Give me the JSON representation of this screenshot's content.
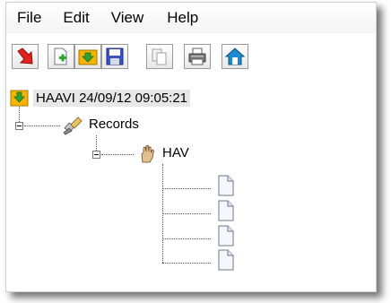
{
  "menu": {
    "file": "File",
    "edit": "Edit",
    "view": "View",
    "help": "Help"
  },
  "toolbar": {
    "buttons": [
      {
        "icon": "exit-arrow-icon",
        "color": "#e0241c"
      },
      {
        "icon": "new-document-icon",
        "color": "#2fa32f"
      },
      {
        "icon": "open-folder-icon",
        "color": "#f5b400"
      },
      {
        "icon": "save-disk-icon",
        "color": "#3a52c8"
      },
      {
        "icon": "copy-icon",
        "color": "#a0a0a0"
      },
      {
        "icon": "print-icon",
        "color": "#606060"
      },
      {
        "icon": "home-icon",
        "color": "#1e8bd0"
      }
    ]
  },
  "tree": {
    "root": {
      "label": "HAAVI 24/09/12 09:05:21",
      "icon": "folder-download-icon"
    },
    "records": {
      "label": "Records",
      "icon": "pencil-icon"
    },
    "hav": {
      "label": "HAV",
      "icon": "hand-icon"
    },
    "documents": [
      {
        "icon": "document-icon"
      },
      {
        "icon": "document-icon"
      },
      {
        "icon": "document-icon"
      },
      {
        "icon": "document-icon"
      }
    ]
  }
}
